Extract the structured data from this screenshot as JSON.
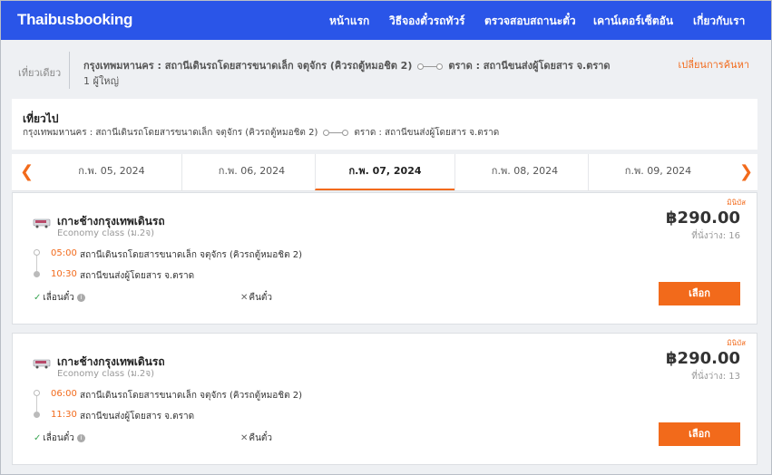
{
  "header": {
    "logo": "Thaibusbooking",
    "nav": [
      "หน้าแรก",
      "วิธีจองตั๋วรถทัวร์",
      "ตรวจสอบสถานะตั๋ว",
      "เคาน์เตอร์เซ็ตอัน",
      "เกี่ยวกับเรา"
    ]
  },
  "summary": {
    "trip_type": "เที่ยวเดียว",
    "from": "กรุงเทพมหานคร : สถานีเดินรถโดยสารขนาดเล็ก จตุจักร (คิวรถตู้หมอชิต 2)",
    "to": "ตราด : สถานีขนส่งผู้โดยสาร จ.ตราด",
    "passengers": "1 ผู้ใหญ่",
    "change_search": "เปลี่ยนการค้นหา"
  },
  "trip": {
    "title": "เที่ยวไป",
    "from": "กรุงเทพมหานคร : สถานีเดินรถโดยสารขนาดเล็ก จตุจักร (คิวรถตู้หมอชิต 2)",
    "to": "ตราด : สถานีขนส่งผู้โดยสาร จ.ตราด"
  },
  "dates": {
    "prev_icon": "chevron-left-icon",
    "next_icon": "chevron-right-icon",
    "items": [
      "ก.พ. 05, 2024",
      "ก.พ. 06, 2024",
      "ก.พ. 07, 2024",
      "ก.พ. 08, 2024",
      "ก.พ. 09, 2024"
    ],
    "active_index": 2
  },
  "results": [
    {
      "badge": "มินิบัส",
      "operator": "เกาะช้างกรุงเทพเดินรถ",
      "class": "Economy class (ม.2จ)",
      "price": "฿290.00",
      "seats": "ที่นั่งว่าง: 16",
      "depart_time": "05:00",
      "depart_place": "สถานีเดินรถโดยสารขนาดเล็ก จตุจักร (คิวรถตู้หมอชิต 2)",
      "arrive_time": "10:30",
      "arrive_place": "สถานีขนส่งผู้โดยสาร จ.ตราด",
      "reschedule": "เลื่อนตั๋ว",
      "refund": "คืนตั๋ว",
      "button": "เลือก"
    },
    {
      "badge": "มินิบัส",
      "operator": "เกาะช้างกรุงเทพเดินรถ",
      "class": "Economy class (ม.2จ)",
      "price": "฿290.00",
      "seats": "ที่นั่งว่าง: 13",
      "depart_time": "06:00",
      "depart_place": "สถานีเดินรถโดยสารขนาดเล็ก จตุจักร (คิวรถตู้หมอชิต 2)",
      "arrive_time": "11:30",
      "arrive_place": "สถานีขนส่งผู้โดยสาร จ.ตราด",
      "reschedule": "เลื่อนตั๋ว",
      "refund": "คืนตั๋ว",
      "button": "เลือก"
    }
  ],
  "colors": {
    "header": "#2a55e8",
    "accent": "#f26a1b",
    "check": "#3aa653"
  }
}
